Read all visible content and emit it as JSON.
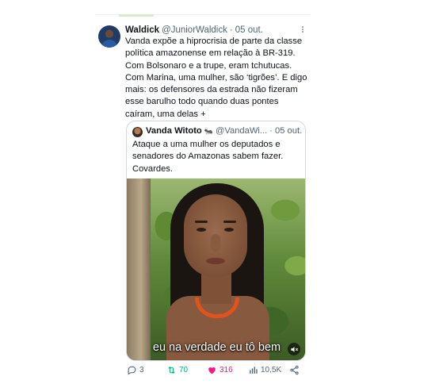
{
  "tweet": {
    "name": "Waldick",
    "handle": "@JuniorWaldick",
    "separator": "·",
    "date": "05 out.",
    "text_lines": [
      "Vanda expõe a hiprocrisia de parte da classe",
      "política amazonense em relação à BR-319.",
      "Com Bolsonaro e a trupe, eram tchutucas.",
      "Com Marina, uma mulher, são ‘tigrões’. E digo",
      "mais: os defensores da estrada não fizeram",
      "esse barulho todo quando duas pontes",
      "caíram, uma delas +"
    ]
  },
  "quote": {
    "name": "Vanda Witoto",
    "emoji": "🐜",
    "handle": "@VandaWi...",
    "separator": "·",
    "date": "05 out.",
    "text_lines": [
      "Ataque a uma mulher os deputados e",
      "senadores do Amazonas sabem fazer.",
      "Covardes."
    ],
    "video": {
      "caption": "eu na verdade eu tô bem",
      "mute_icon": "speaker-muted-icon"
    }
  },
  "actions": {
    "replies": "3",
    "retweets": "70",
    "likes": "316",
    "views": "10,5K"
  },
  "colors": {
    "text": "#0f1419",
    "secondary": "#536471",
    "retweet": "#00ba7c",
    "like": "#f91880",
    "border": "#cfd9de"
  }
}
